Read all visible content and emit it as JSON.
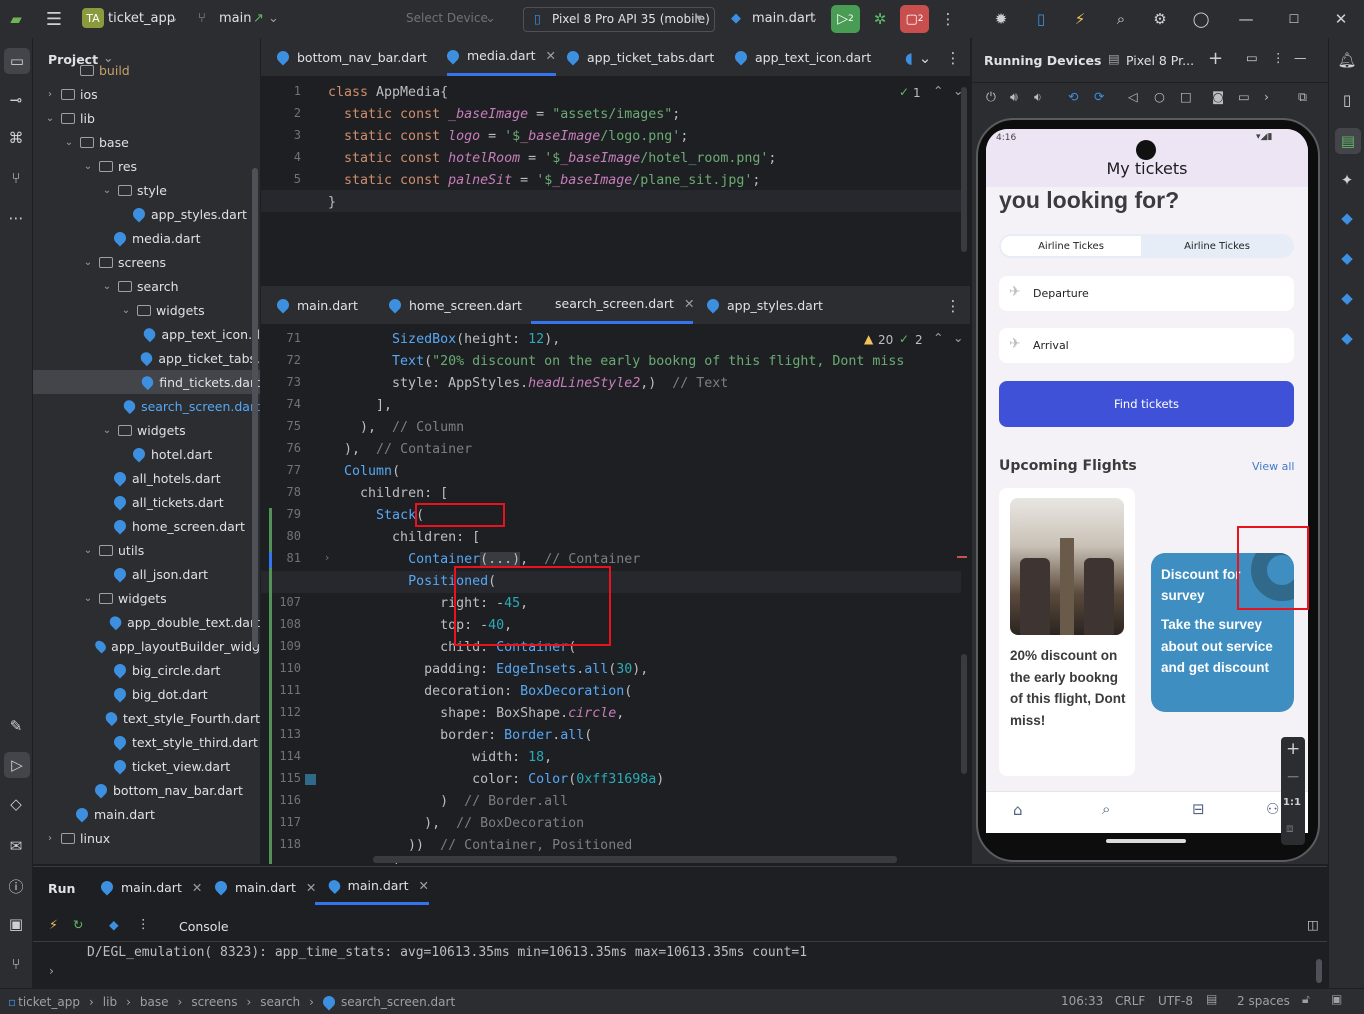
{
  "titlebar": {
    "project_badge": "TA",
    "project_name": "ticket_app",
    "branch": "main",
    "select_device": "Select Device",
    "device": "Pixel 8 Pro API 35 (mobile)",
    "run_config": "main.dart",
    "run_badge": "2",
    "stop_badge": "2"
  },
  "project": {
    "title": "Project",
    "items": [
      {
        "label": "build",
        "type": "folder",
        "indent": 1,
        "chev": ""
      },
      {
        "label": "ios",
        "type": "folder",
        "indent": 0,
        "chev": "›"
      },
      {
        "label": "lib",
        "type": "folder",
        "indent": 0,
        "chev": "⌄"
      },
      {
        "label": "base",
        "type": "folder",
        "indent": 1,
        "chev": "⌄"
      },
      {
        "label": "res",
        "type": "folder",
        "indent": 2,
        "chev": "⌄"
      },
      {
        "label": "style",
        "type": "folder",
        "indent": 3,
        "chev": "⌄"
      },
      {
        "label": "app_styles.dart",
        "type": "dart",
        "indent": 4,
        "chev": ""
      },
      {
        "label": "media.dart",
        "type": "dart",
        "indent": 3,
        "chev": ""
      },
      {
        "label": "screens",
        "type": "folder",
        "indent": 2,
        "chev": "⌄"
      },
      {
        "label": "search",
        "type": "folder",
        "indent": 3,
        "chev": "⌄"
      },
      {
        "label": "widgets",
        "type": "folder",
        "indent": 4,
        "chev": "⌄"
      },
      {
        "label": "app_text_icon.d",
        "type": "dart",
        "indent": 5,
        "chev": ""
      },
      {
        "label": "app_ticket_tabs.",
        "type": "dart",
        "indent": 5,
        "chev": ""
      },
      {
        "label": "find_tickets.dart",
        "type": "dart",
        "indent": 5,
        "chev": "",
        "selected": true
      },
      {
        "label": "search_screen.dart",
        "type": "dart",
        "indent": 4,
        "chev": "",
        "accent": true
      },
      {
        "label": "widgets",
        "type": "folder",
        "indent": 3,
        "chev": "⌄"
      },
      {
        "label": "hotel.dart",
        "type": "dart",
        "indent": 4,
        "chev": ""
      },
      {
        "label": "all_hotels.dart",
        "type": "dart",
        "indent": 3,
        "chev": ""
      },
      {
        "label": "all_tickets.dart",
        "type": "dart",
        "indent": 3,
        "chev": ""
      },
      {
        "label": "home_screen.dart",
        "type": "dart",
        "indent": 3,
        "chev": ""
      },
      {
        "label": "utils",
        "type": "folder",
        "indent": 2,
        "chev": "⌄"
      },
      {
        "label": "all_json.dart",
        "type": "dart",
        "indent": 3,
        "chev": ""
      },
      {
        "label": "widgets",
        "type": "folder",
        "indent": 2,
        "chev": "⌄"
      },
      {
        "label": "app_double_text.dart",
        "type": "dart",
        "indent": 3,
        "chev": ""
      },
      {
        "label": "app_layoutBuilder_widg",
        "type": "dart",
        "indent": 3,
        "chev": ""
      },
      {
        "label": "big_circle.dart",
        "type": "dart",
        "indent": 3,
        "chev": ""
      },
      {
        "label": "big_dot.dart",
        "type": "dart",
        "indent": 3,
        "chev": ""
      },
      {
        "label": "text_style_Fourth.dart",
        "type": "dart",
        "indent": 3,
        "chev": ""
      },
      {
        "label": "text_style_third.dart",
        "type": "dart",
        "indent": 3,
        "chev": ""
      },
      {
        "label": "ticket_view.dart",
        "type": "dart",
        "indent": 3,
        "chev": ""
      },
      {
        "label": "bottom_nav_bar.dart",
        "type": "dart",
        "indent": 2,
        "chev": ""
      },
      {
        "label": "main.dart",
        "type": "dart",
        "indent": 1,
        "chev": ""
      },
      {
        "label": "linux",
        "type": "folder",
        "indent": 0,
        "chev": "›"
      }
    ]
  },
  "editor_top": {
    "tabs": [
      "bottom_nav_bar.dart",
      "media.dart",
      "app_ticket_tabs.dart",
      "app_text_icon.dart"
    ],
    "active_tab": "media.dart",
    "inspection": "1",
    "line_numbers": [
      "1",
      "2",
      "3",
      "4",
      "5",
      "6"
    ]
  },
  "editor_bottom": {
    "tabs": [
      "main.dart",
      "home_screen.dart",
      "search_screen.dart",
      "app_styles.dart"
    ],
    "active_tab": "search_screen.dart",
    "warnings": "20",
    "checks": "2",
    "line_numbers": [
      "71",
      "72",
      "73",
      "74",
      "75",
      "76",
      "77",
      "78",
      "79",
      "80",
      "81",
      "106",
      "107",
      "108",
      "109",
      "110",
      "111",
      "112",
      "113",
      "114",
      "115",
      "116",
      "117",
      "118"
    ]
  },
  "devices": {
    "title": "Running Devices",
    "device_tab": "Pixel 8 Pr...",
    "zoom_label": "1:1"
  },
  "phone": {
    "status_time": "4:16",
    "appbar_title": "My tickets",
    "heading": "you looking for?",
    "tabs": [
      "Airline Tickes",
      "Airline Tickes"
    ],
    "departure": "Departure",
    "arrival": "Arrival",
    "find_button": "Find tickets",
    "upcoming": "Upcoming Flights",
    "view_all": "View all",
    "card1_text": "20% discount on the early bookng of this flight, Dont miss!",
    "card2_title": "Discount for survey",
    "card2_body": "Take the survey about out service and get discount",
    "accent_blue": "#3f51d6",
    "card_blue": "#3e8ec2"
  },
  "run": {
    "title": "Run",
    "tabs": [
      "main.dart",
      "main.dart",
      "main.dart"
    ],
    "console_label": "Console",
    "log_line": "D/EGL_emulation( 8323): app_time_stats: avg=10613.35ms min=10613.35ms max=10613.35ms count=1"
  },
  "status": {
    "crumbs": [
      "ticket_app",
      "lib",
      "base",
      "screens",
      "search",
      "search_screen.dart"
    ],
    "position": "106:33",
    "line_sep": "CRLF",
    "encoding": "UTF-8",
    "indent": "2 spaces"
  }
}
